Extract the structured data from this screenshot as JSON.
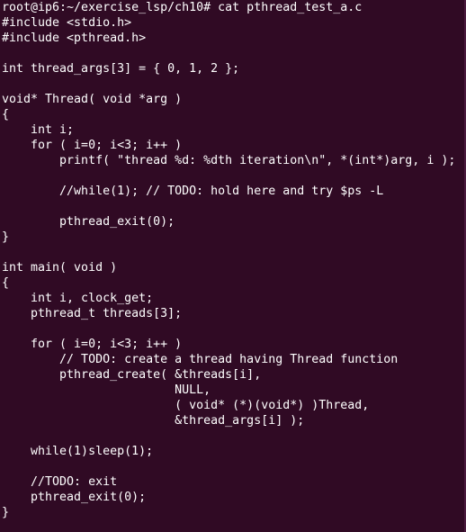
{
  "terminal": {
    "prompt_line": "root@ip6:~/exercise_lsp/ch10# cat pthread_test_a.c",
    "lines": [
      "#include <stdio.h>",
      "#include <pthread.h>",
      "",
      "int thread_args[3] = { 0, 1, 2 };",
      "",
      "void* Thread( void *arg )",
      "{",
      "    int i;",
      "    for ( i=0; i<3; i++ )",
      "        printf( \"thread %d: %dth iteration\\n\", *(int*)arg, i );",
      "",
      "        //while(1); // TODO: hold here and try $ps -L",
      "",
      "        pthread_exit(0);",
      "}",
      "",
      "int main( void )",
      "{",
      "    int i, clock_get;",
      "    pthread_t threads[3];",
      "",
      "    for ( i=0; i<3; i++ )",
      "        // TODO: create a thread having Thread function",
      "        pthread_create( &threads[i],",
      "                        NULL,",
      "                        ( void* (*)(void*) )Thread,",
      "                        &thread_args[i] );",
      "",
      "    while(1)sleep(1);",
      "",
      "    //TODO: exit",
      "    pthread_exit(0);",
      "}"
    ]
  }
}
